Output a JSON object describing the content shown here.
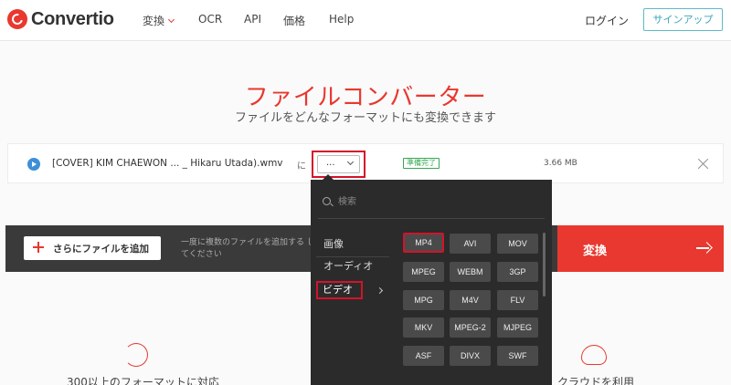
{
  "header": {
    "logo_text": "Convertio",
    "nav": [
      "変換",
      "OCR",
      "API",
      "価格",
      "Help"
    ],
    "login": "ログイン",
    "signup": "サインアップ"
  },
  "hero": {
    "title": "ファイルコンバーター",
    "subtitle": "ファイルをどんなフォーマットにも変換できます"
  },
  "file": {
    "name": "[COVER] KIM CHAEWON ... _ Hikaru Utada).wmv",
    "to_label": "に",
    "format_value": "...",
    "status": "準備完了",
    "size": "3.66 MB"
  },
  "action_bar": {
    "add_label": "さらにファイルを追加",
    "hint": "一度に複数のファイルを追加する してください",
    "convert_label": "変換"
  },
  "features": {
    "left": "300以上のフォーマットに対応",
    "right": "クラウドを利用"
  },
  "dropdown": {
    "search_placeholder": "検索",
    "categories": [
      "画像",
      "オーディオ",
      "ビデオ"
    ],
    "selected_category": "ビデオ",
    "formats": [
      "MP4",
      "AVI",
      "MOV",
      "MPEG",
      "WEBM",
      "3GP",
      "MPG",
      "M4V",
      "FLV",
      "MKV",
      "MPEG-2",
      "MJPEG",
      "ASF",
      "DIVX",
      "SWF"
    ],
    "highlighted_format": "MP4"
  },
  "colors": {
    "brand_red": "#e8382f",
    "highlight_red": "#d3132a",
    "signup_teal": "#3aa5b8",
    "status_green": "#36a853",
    "dark_bar": "#3a3a3a",
    "dropdown_bg": "#2b2b2b"
  },
  "icons": [
    "logo-icon",
    "chevron-down-icon",
    "play-icon",
    "close-icon",
    "plus-icon",
    "arrow-right-icon",
    "search-icon",
    "chevron-right-icon",
    "sync-icon",
    "cloud-upload-icon"
  ]
}
